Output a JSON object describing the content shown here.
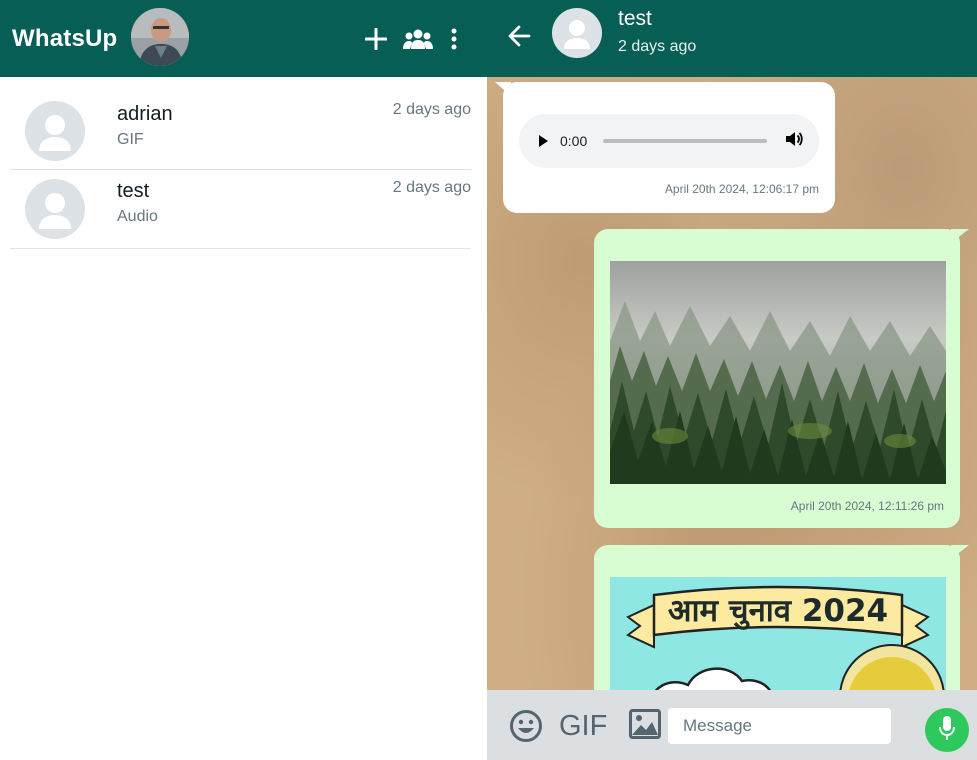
{
  "app": {
    "title": "WhatsUp"
  },
  "header_icons": [
    "plus-icon",
    "group-icon",
    "more-vertical-icon"
  ],
  "chats": [
    {
      "name": "adrian",
      "last_message": "GIF",
      "time": "2 days ago"
    },
    {
      "name": "test",
      "last_message": "Audio",
      "time": "2 days ago"
    }
  ],
  "conversation": {
    "contact_name": "test",
    "contact_status": "2 days ago",
    "messages": [
      {
        "type": "audio",
        "direction": "incoming",
        "audio_time": "0:00",
        "timestamp": "April 20th 2024, 12:06:17 pm"
      },
      {
        "type": "image",
        "direction": "outgoing",
        "image": "misty forest",
        "timestamp": "April 20th 2024, 12:11:26 pm"
      },
      {
        "type": "image",
        "direction": "outgoing",
        "image": "election banner",
        "image_text": "आम चुनाव 2024"
      }
    ]
  },
  "input": {
    "placeholder": "Message",
    "value": "",
    "gif_label": "GIF"
  },
  "colors": {
    "header": "#075e54",
    "outgoing_bubble": "#d9fdd3",
    "mic": "#2ec95d"
  }
}
